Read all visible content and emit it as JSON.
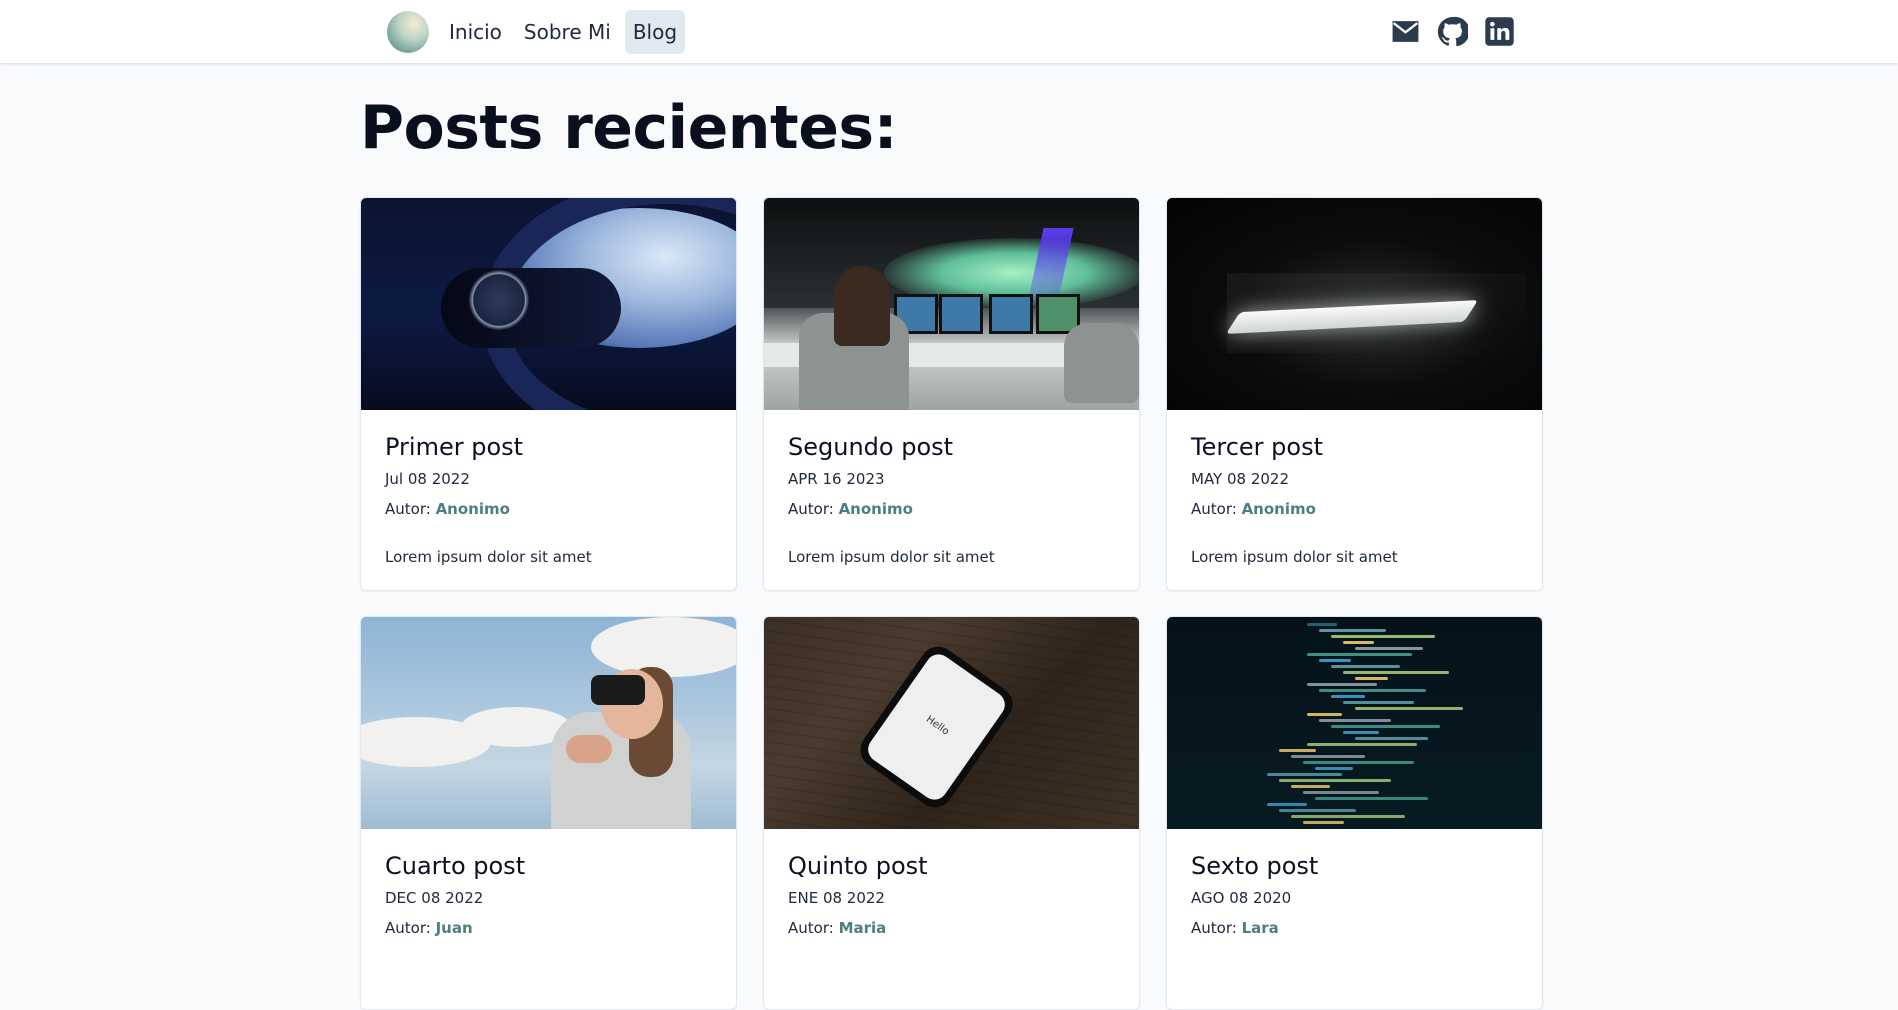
{
  "nav": {
    "links": [
      {
        "label": "Inicio",
        "active": false
      },
      {
        "label": "Sobre Mi",
        "active": false
      },
      {
        "label": "Blog",
        "active": true
      }
    ],
    "icons": [
      "mail-icon",
      "github-icon",
      "linkedin-icon"
    ]
  },
  "page": {
    "title": "Posts recientes:"
  },
  "posts": [
    {
      "title": "Primer post",
      "date": "Jul 08 2022",
      "author_label": "Autor:",
      "author": "Anonimo",
      "excerpt": "Lorem ipsum dolor sit amet",
      "image": "wristwatch-airplane-window"
    },
    {
      "title": "Segundo post",
      "date": "APR 16 2023",
      "author_label": "Autor:",
      "author": "Anonimo",
      "excerpt": "Lorem ipsum dolor sit amet",
      "image": "control-room-monitors"
    },
    {
      "title": "Tercer post",
      "date": "MAY 08 2022",
      "author_label": "Autor:",
      "author": "Anonimo",
      "excerpt": "Lorem ipsum dolor sit amet",
      "image": "glowing-laptop-dark"
    },
    {
      "title": "Cuarto post",
      "date": "DEC 08 2022",
      "author_label": "Autor:",
      "author": "Juan",
      "excerpt": "",
      "image": "woman-vr-headset-sky"
    },
    {
      "title": "Quinto post",
      "date": "ENE 08 2022",
      "author_label": "Autor:",
      "author": "Maria",
      "excerpt": "",
      "image": "phone-on-wood-table",
      "image_text": "Hello"
    },
    {
      "title": "Sexto post",
      "date": "AGO 08 2020",
      "author_label": "Autor:",
      "author": "Lara",
      "excerpt": "",
      "image": "code-on-screen"
    }
  ],
  "colors": {
    "accent_author": "#4d7f82",
    "background": "#f8fafc",
    "nav_active": "#e2e8f0"
  }
}
